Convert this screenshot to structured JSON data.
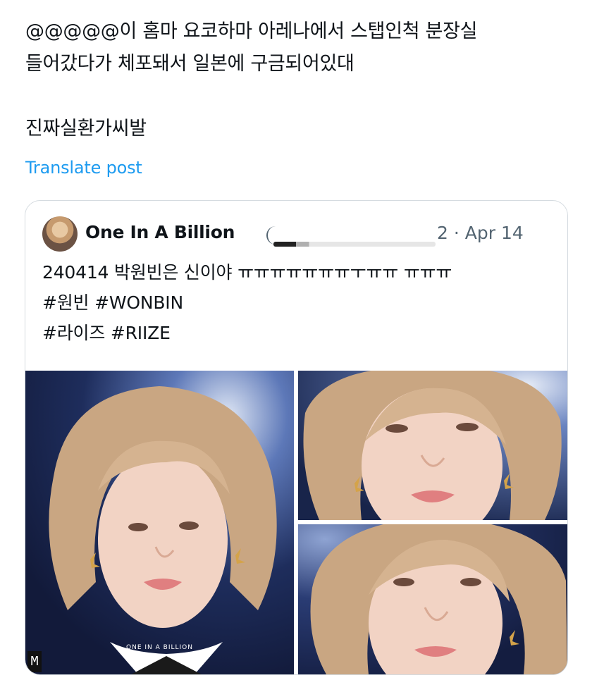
{
  "post": {
    "lines": [
      "@@@@@이 홈마 요코하마 아레나에서 스탭인척 분장실",
      "들어갔다가 체포돼서 일본에 구금되어있대",
      "진짜실환가씨발"
    ],
    "translate_label": "Translate post"
  },
  "quoted": {
    "author_name": "One In A Billion",
    "date": "2 · Apr 14",
    "body_lines": [
      "240414 박원빈은 신이야 ㅠㅠㅠㅠㅠㅠㅠㅜㅠㅠ ㅠㅠㅠ",
      "#원빈 #WONBIN",
      "#라이즈 #RIIZE"
    ],
    "watermark": "ONE IN A BILLION",
    "logo_mark": "M"
  },
  "colors": {
    "link": "#1d9bf0",
    "text": "#0f1419",
    "muted": "#536471",
    "border": "#d5dbe0",
    "photo_bg": "#1b2a52",
    "hair": "#cfae8c",
    "skin": "#f0d2c2"
  }
}
